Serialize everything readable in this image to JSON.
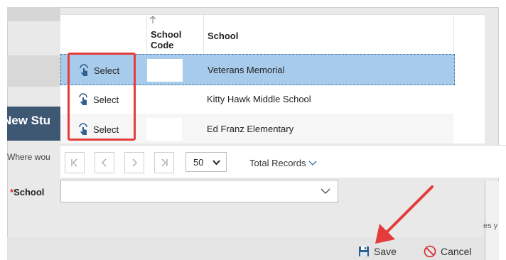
{
  "dialog": {
    "header_text": "New Stu",
    "prompt_text": "Where wou",
    "school_label": "School",
    "required_marker": "*",
    "hint_text": "es y"
  },
  "grid": {
    "columns": [
      {
        "label": "School Code",
        "sorted": "ascending"
      },
      {
        "label": "School"
      }
    ],
    "rows": [
      {
        "action": "Select",
        "code": "",
        "school": "Veterans Memorial",
        "selected": true
      },
      {
        "action": "Select",
        "code": "",
        "school": "Kitty Hawk Middle School",
        "selected": false
      },
      {
        "action": "Select",
        "code": "",
        "school": "Ed Franz Elementary",
        "selected": false
      }
    ]
  },
  "pager": {
    "page_size": "50",
    "total_label": "Total Records"
  },
  "footer": {
    "save_label": "Save",
    "cancel_label": "Cancel"
  },
  "colors": {
    "selected_row": "#a7cbea",
    "header_bg": "#3e5874",
    "annotation": "#e53b3b",
    "select_icon": "#2f5f8f",
    "cancel_icon": "#d9262b"
  },
  "icons": {
    "select": "touch-hand-icon",
    "save": "floppy-disk-icon",
    "cancel": "no-entry-icon"
  }
}
